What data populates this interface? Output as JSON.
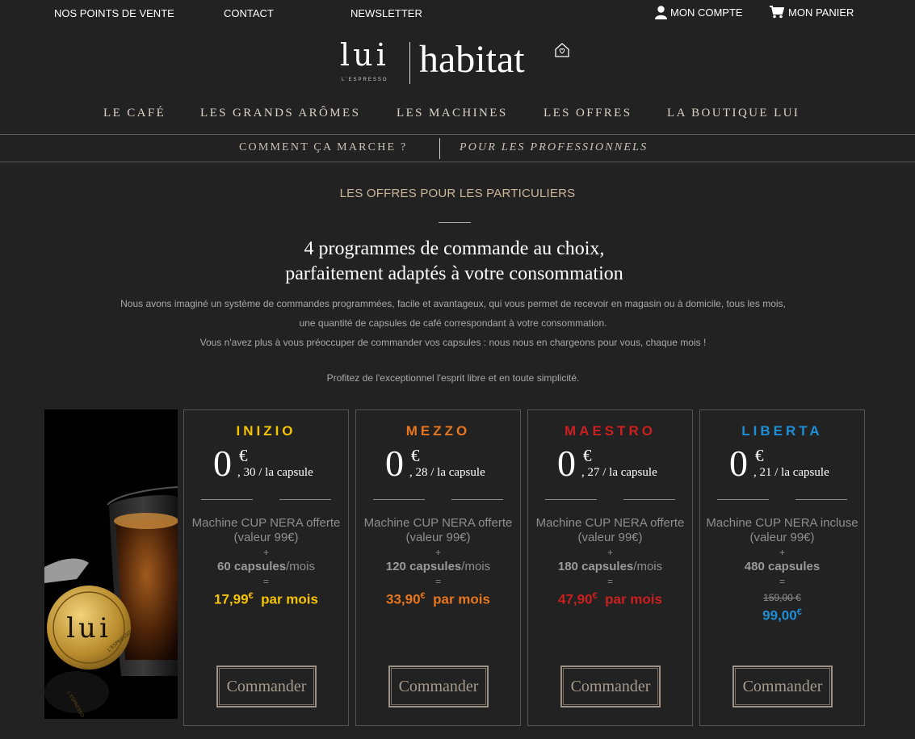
{
  "util": {
    "points_de_vente": "NOS POINTS DE VENTE",
    "contact": "CONTACT",
    "newsletter": "NEWSLETTER",
    "compte": "MON COMPTE",
    "panier": "MON PANIER"
  },
  "logo": {
    "lui": "lui",
    "espresso": "L'ESPRESSO",
    "habitat": "habitat"
  },
  "nav": {
    "items": [
      "LE CAFÉ",
      "LES GRANDS ARÔMES",
      "LES MACHINES",
      "LES OFFRES",
      "LA BOUTIQUE LUI"
    ],
    "sub": [
      "COMMENT ÇA MARCHE ?",
      "POUR LES PROFESSIONNELS"
    ]
  },
  "intro": {
    "kicker": "LES OFFRES POUR LES PARTICULIERS",
    "headline_1": "4 programmes de commande au choix,",
    "headline_2": "parfaitement adaptés à votre consommation",
    "desc_1": "Nous avons imaginé un système de commandes programmées, facile et avantageux, qui vous permet de recevoir en magasin ou à domicile, tous les mois,",
    "desc_2": "une quantité de capsules de café correspondant à votre consommation.",
    "desc_3": "Vous n'avez plus à vous préoccuper de commander vos capsules : nous nous en chargeons pour vous, chaque mois !",
    "desc_4": "Profitez de l'exceptionnel l'esprit libre et en toute simplicité."
  },
  "colors": {
    "inizio": "#f5c400",
    "mezzo": "#e8761f",
    "maestro": "#cc1f1f",
    "liberta": "#1e8fd6"
  },
  "offers": [
    {
      "name": "INIZIO",
      "price_int": "0",
      "currency": "€",
      "price_cents": ", 30 / la capsule",
      "machine": "Machine CUP NERA offerte",
      "valeur": "(valeur 99€)",
      "plus": "+",
      "capsules": "60 capsules",
      "period": "/mois",
      "equals": "=",
      "total": "17,99",
      "total_cur": "€",
      "total_suffix": "par mois",
      "cta": "Commander"
    },
    {
      "name": "MEZZO",
      "price_int": "0",
      "currency": "€",
      "price_cents": ", 28 / la capsule",
      "machine": "Machine CUP NERA offerte",
      "valeur": "(valeur 99€)",
      "plus": "+",
      "capsules": "120 capsules",
      "period": "/mois",
      "equals": "=",
      "total": "33,90",
      "total_cur": "€",
      "total_suffix": "par mois",
      "cta": "Commander"
    },
    {
      "name": "MAESTRO",
      "price_int": "0",
      "currency": "€",
      "price_cents": ", 27 / la capsule",
      "machine": "Machine CUP NERA offerte",
      "valeur": "(valeur 99€)",
      "plus": "+",
      "capsules": "180 capsules",
      "period": "/mois",
      "equals": "=",
      "total": "47,90",
      "total_cur": "€",
      "total_suffix": "par mois",
      "cta": "Commander"
    },
    {
      "name": "LIBERTA",
      "price_int": "0",
      "currency": "€",
      "price_cents": ", 21 / la capsule",
      "machine": "Machine CUP NERA incluse",
      "valeur": "(valeur 99€)",
      "plus": "+",
      "capsules": "480 capsules",
      "equals": "=",
      "old_price": "159,00 €",
      "total": "99,00",
      "total_cur": "€",
      "cta": "Commander"
    }
  ],
  "photo_capsule_text": "L'ESPRESSO"
}
